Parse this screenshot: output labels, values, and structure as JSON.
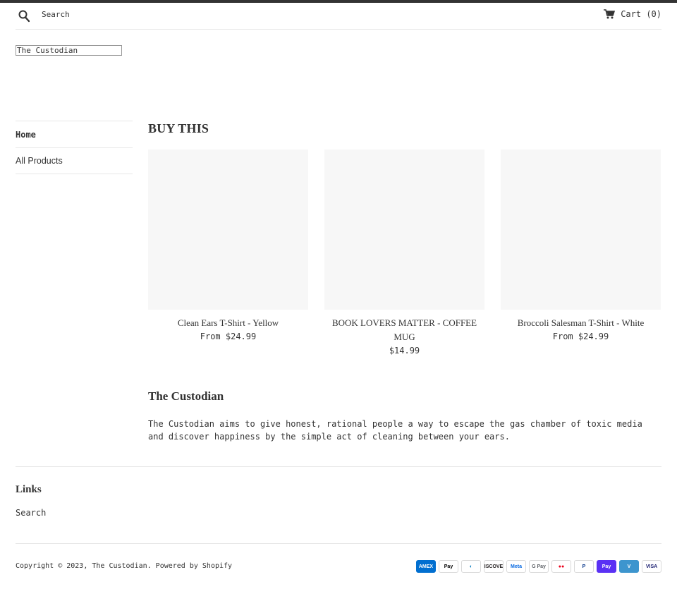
{
  "header": {
    "search_label": "Search",
    "cart_label": "Cart (0)"
  },
  "logo_text": "The Custodian",
  "sidenav": {
    "items": [
      {
        "label": "Home"
      },
      {
        "label": "All Products"
      }
    ]
  },
  "collection": {
    "title": "BUY THIS",
    "products": [
      {
        "title": "Clean Ears T-Shirt - Yellow",
        "price": "From $24.99"
      },
      {
        "title": "BOOK LOVERS MATTER - COFFEE MUG",
        "price": "$14.99"
      },
      {
        "title": "Broccoli Salesman T-Shirt - White",
        "price": "From $24.99"
      }
    ]
  },
  "about": {
    "title": "The Custodian",
    "text": "The Custodian aims to give honest, rational people a way to escape the gas chamber of toxic media and discover happiness by the simple act of cleaning between your ears."
  },
  "footer": {
    "links_title": "Links",
    "links": [
      {
        "label": "Search"
      }
    ],
    "copyright": "Copyright © 2023, The Custodian. Powered by Shopify",
    "payment_icons": [
      {
        "name": "amex-icon",
        "label": "AMEX",
        "bg": "#016fd0",
        "fg": "#ffffff"
      },
      {
        "name": "apple-pay-icon",
        "label": "Pay",
        "bg": "#ffffff",
        "fg": "#000000"
      },
      {
        "name": "diners-club-icon",
        "label": "◐",
        "bg": "#ffffff",
        "fg": "#0079be"
      },
      {
        "name": "discover-icon",
        "label": "DISCOVER",
        "bg": "#ffffff",
        "fg": "#231f20"
      },
      {
        "name": "meta-pay-icon",
        "label": "Meta",
        "bg": "#ffffff",
        "fg": "#0668e1"
      },
      {
        "name": "google-pay-icon",
        "label": "G Pay",
        "bg": "#ffffff",
        "fg": "#5f6368"
      },
      {
        "name": "mastercard-icon",
        "label": "●●",
        "bg": "#ffffff",
        "fg": "#eb001b"
      },
      {
        "name": "paypal-icon",
        "label": "P",
        "bg": "#ffffff",
        "fg": "#003087"
      },
      {
        "name": "shop-pay-icon",
        "label": "Pay",
        "bg": "#5a31f4",
        "fg": "#ffffff"
      },
      {
        "name": "venmo-icon",
        "label": "V",
        "bg": "#3d95ce",
        "fg": "#ffffff"
      },
      {
        "name": "visa-icon",
        "label": "VISA",
        "bg": "#ffffff",
        "fg": "#1a1f71"
      }
    ]
  },
  "colors": {
    "text": "#333333",
    "rule": "#e8e8e8",
    "image_placeholder": "#f7f7f7"
  }
}
